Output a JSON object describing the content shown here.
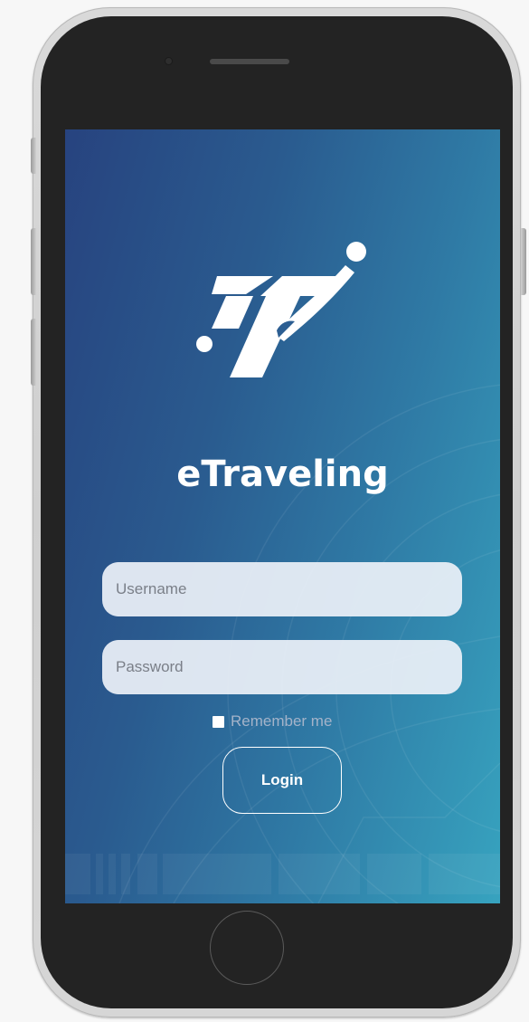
{
  "app": {
    "name": "eTraveling"
  },
  "login_form": {
    "username_placeholder": "Username",
    "password_placeholder": "Password",
    "remember_label": "Remember me",
    "login_label": "Login"
  },
  "colors": {
    "gradient_start": "#27437f",
    "gradient_end": "#37a3bf",
    "text_primary": "#ffffff",
    "field_bg": "#ebf0f7",
    "remember_text": "#a4b3c9",
    "phone_frame": "#232323"
  },
  "icons": {
    "logo": "etraveling-logo",
    "home_button": "home-button-ring",
    "camera": "front-camera",
    "speaker": "earpiece-speaker"
  }
}
